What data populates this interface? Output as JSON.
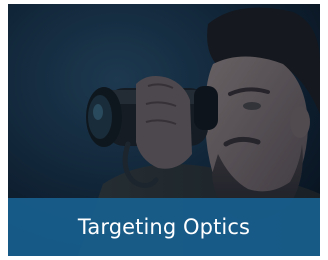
{
  "card": {
    "caption": "Targeting Optics",
    "caption_bg": "#185f8e",
    "caption_color": "#ffffff",
    "image_subject": "man-looking-through-thermal-monocular"
  }
}
